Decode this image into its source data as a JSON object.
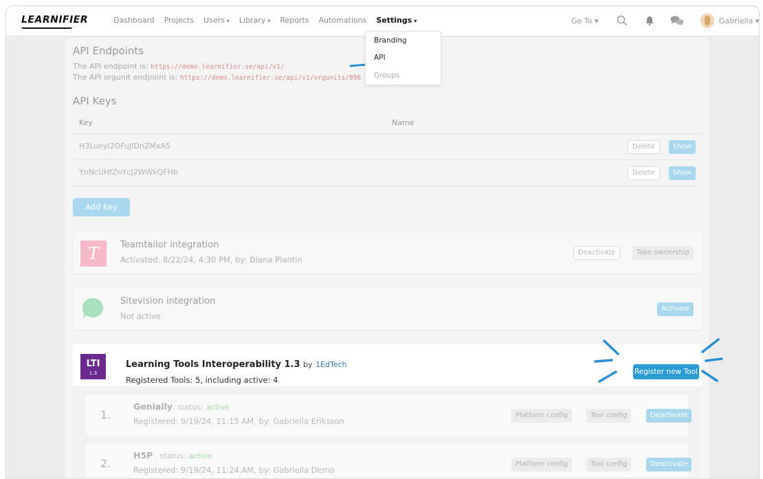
{
  "nav": {
    "logo": "LEARNIFIER",
    "items": [
      {
        "label": "Dashboard"
      },
      {
        "label": "Projects"
      },
      {
        "label": "Users",
        "caret": "▾"
      },
      {
        "label": "Library",
        "caret": "▾"
      },
      {
        "label": "Reports"
      },
      {
        "label": "Automations"
      },
      {
        "label": "Settings",
        "caret": "▾",
        "active": true
      }
    ],
    "goto": "Go To ▾",
    "user": "Gabriella ▾"
  },
  "dropdown": {
    "items": [
      "Branding",
      "API",
      "Groups"
    ]
  },
  "api": {
    "endpoints_title": "API Endpoints",
    "endpoint_label": "The API endpoint is:",
    "endpoint_url": "https://demo.learnifier.se/api/v1/",
    "orgunit_label": "The API orgunit endpoint is:",
    "orgunit_url": "https://demo.learnifier.se/api/v1/orgunits/898",
    "keys_title": "API Keys",
    "col_key": "Key",
    "col_name": "Name",
    "keys": [
      {
        "key": "H3LuoyI2OFuJIDnZMxA5",
        "delete": "Delete",
        "show": "Show"
      },
      {
        "key": "YnNcUHfZnYcJ2WWkQFHb",
        "delete": "Delete",
        "show": "Show"
      }
    ],
    "add_key": "Add Key"
  },
  "integrations": {
    "teamtailor": {
      "logo_letter": "T",
      "title": "Teamtailor integration",
      "subtitle_prefix": "Activated: 8/22/24, 4:30 PM, by:",
      "subtitle_user": "Diana Plantin",
      "deactivate": "Deactivate",
      "take_ownership": "Take ownership"
    },
    "sitevision": {
      "title": "Sitevision integration",
      "subtitle": "Not active",
      "activate": "Activate"
    },
    "lti": {
      "logo_top": "LTI",
      "logo_bottom": "1.3",
      "title": "Learning Tools Interoperability 1.3",
      "by": "by",
      "vendor": "1EdTech",
      "subtitle": "Registered Tools: 5, including active: 4",
      "register": "Register new Tool",
      "tools": [
        {
          "num": "1.",
          "name": "Genially",
          "status_label": ", status:",
          "status": "active",
          "registered": "Registered: 9/19/24, 11:15 AM, by: Gabriella Eriksson",
          "platform": "Platform config",
          "tool": "Tool config",
          "deactivate": "Deactivate"
        },
        {
          "num": "2.",
          "name": "H5P",
          "status_label": " , status:",
          "status": "active",
          "registered": "Registered: 9/19/24, 11:24 AM, by: Gabriella Demo",
          "platform": "Platform config",
          "tool": "Tool config",
          "deactivate": "Deactivate"
        }
      ]
    }
  },
  "colors": {
    "accent_blue": "#2b9bd2",
    "light_blue": "#a9d8ee",
    "annotation": "#2a8fd0",
    "lti_purple": "#6b2a8e"
  }
}
